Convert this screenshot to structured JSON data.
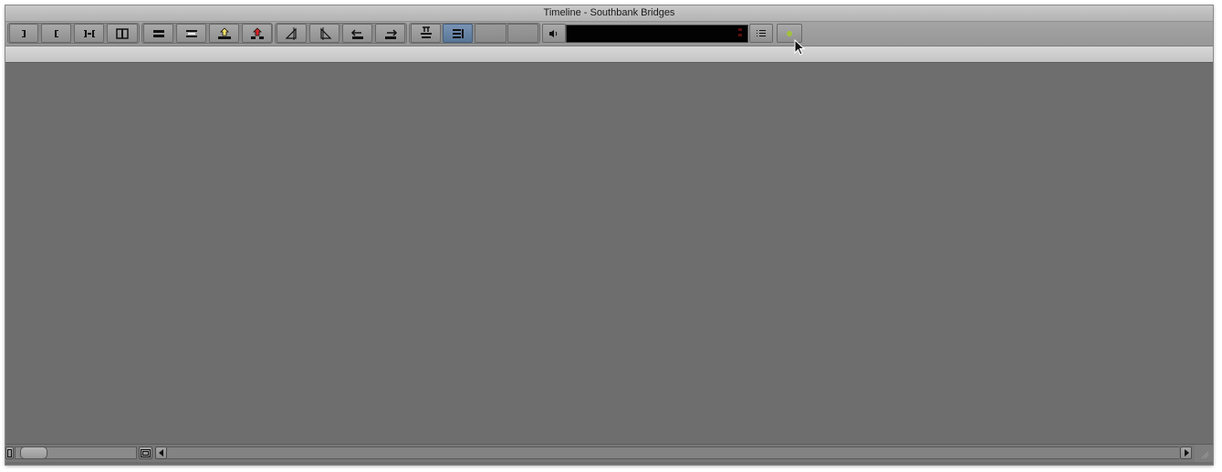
{
  "window": {
    "title": "Timeline - Southbank Bridges"
  },
  "toolbar": {
    "buttons": [
      {
        "name": "mark-out-icon",
        "state": "normal"
      },
      {
        "name": "mark-in-icon",
        "state": "normal"
      },
      {
        "name": "mark-in-out-icon",
        "state": "normal"
      },
      {
        "name": "mark-clip-icon",
        "state": "normal"
      },
      {
        "name": "splice-in-icon",
        "state": "normal"
      },
      {
        "name": "overwrite-icon",
        "state": "normal"
      },
      {
        "name": "lift-icon",
        "state": "normal"
      },
      {
        "name": "extract-icon",
        "state": "normal"
      },
      {
        "name": "trim-mode-icon",
        "state": "normal"
      },
      {
        "name": "trim-single-roller-icon",
        "state": "normal"
      },
      {
        "name": "segment-lift-icon",
        "state": "normal"
      },
      {
        "name": "segment-extract-icon",
        "state": "normal"
      },
      {
        "name": "top-icon",
        "state": "normal"
      },
      {
        "name": "timeline-view-icon",
        "state": "active"
      },
      {
        "name": "blank-button-1",
        "state": "blank"
      },
      {
        "name": "blank-button-2",
        "state": "blank"
      },
      {
        "name": "speaker-icon",
        "state": "normal"
      },
      {
        "name": "fast-menu-icon",
        "state": "normal"
      },
      {
        "name": "status-dot-icon",
        "state": "normal"
      }
    ],
    "accent_color": "#5a7697",
    "status_dot_color": "#a3c23a"
  },
  "audio_meter": {
    "background": "#020202",
    "peak_color": "#5a0d0d"
  }
}
